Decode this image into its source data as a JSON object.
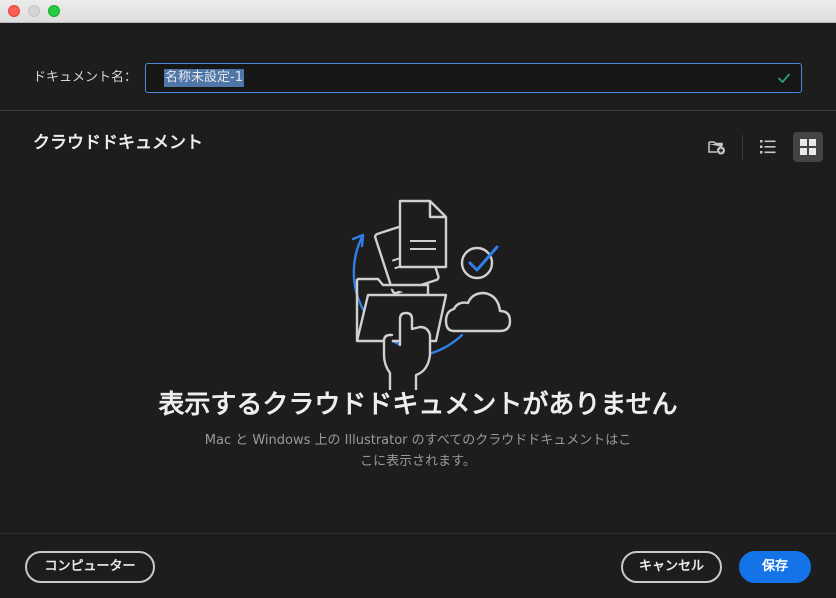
{
  "window": {
    "controls": [
      "close",
      "minimize",
      "maximize"
    ]
  },
  "document_name": {
    "label": "ドキュメント名：",
    "value": "名称未設定-1",
    "status_icon": "checkmark-icon"
  },
  "section": {
    "title": "クラウドドキュメント"
  },
  "toolbar": {
    "new_folder_icon": "folder-add-icon",
    "list_view_icon": "list-view-icon",
    "grid_view_icon": "grid-view-icon",
    "selected_view": "grid"
  },
  "empty_state": {
    "title": "表示するクラウドドキュメントがありません",
    "description_line1": "Mac と Windows 上の Illustrator のすべてのクラウドドキュメントはこ",
    "description_line2": "こに表示されます。"
  },
  "footer": {
    "computer_button": "コンピューター",
    "cancel_button": "キャンセル",
    "save_button": "保存"
  },
  "colors": {
    "accent": "#1473e6",
    "background": "#1d1d1d",
    "check": "#2d9d78"
  }
}
